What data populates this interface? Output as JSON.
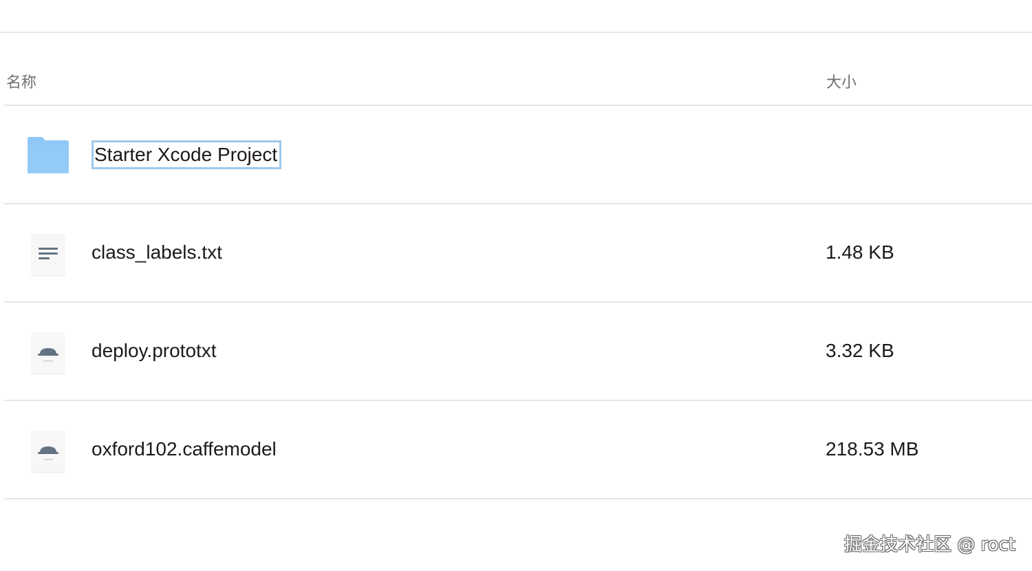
{
  "columns": {
    "name": "名称",
    "size": "大小"
  },
  "files": [
    {
      "name": "Starter Xcode Project",
      "size": "",
      "icon": "folder-icon",
      "selected": true
    },
    {
      "name": "class_labels.txt",
      "size": "1.48 KB",
      "icon": "text-file-icon",
      "selected": false
    },
    {
      "name": "deploy.prototxt",
      "size": "3.32 KB",
      "icon": "generic-file-icon",
      "selected": false
    },
    {
      "name": "oxford102.caffemodel",
      "size": "218.53 MB",
      "icon": "generic-file-icon",
      "selected": false
    }
  ],
  "colors": {
    "folder": "#8fc8f6",
    "selection_border": "#9cc8ec",
    "divider": "#e6e6e6",
    "icon_gray": "#637282"
  },
  "watermark": "掘金技术社区 @ roct"
}
